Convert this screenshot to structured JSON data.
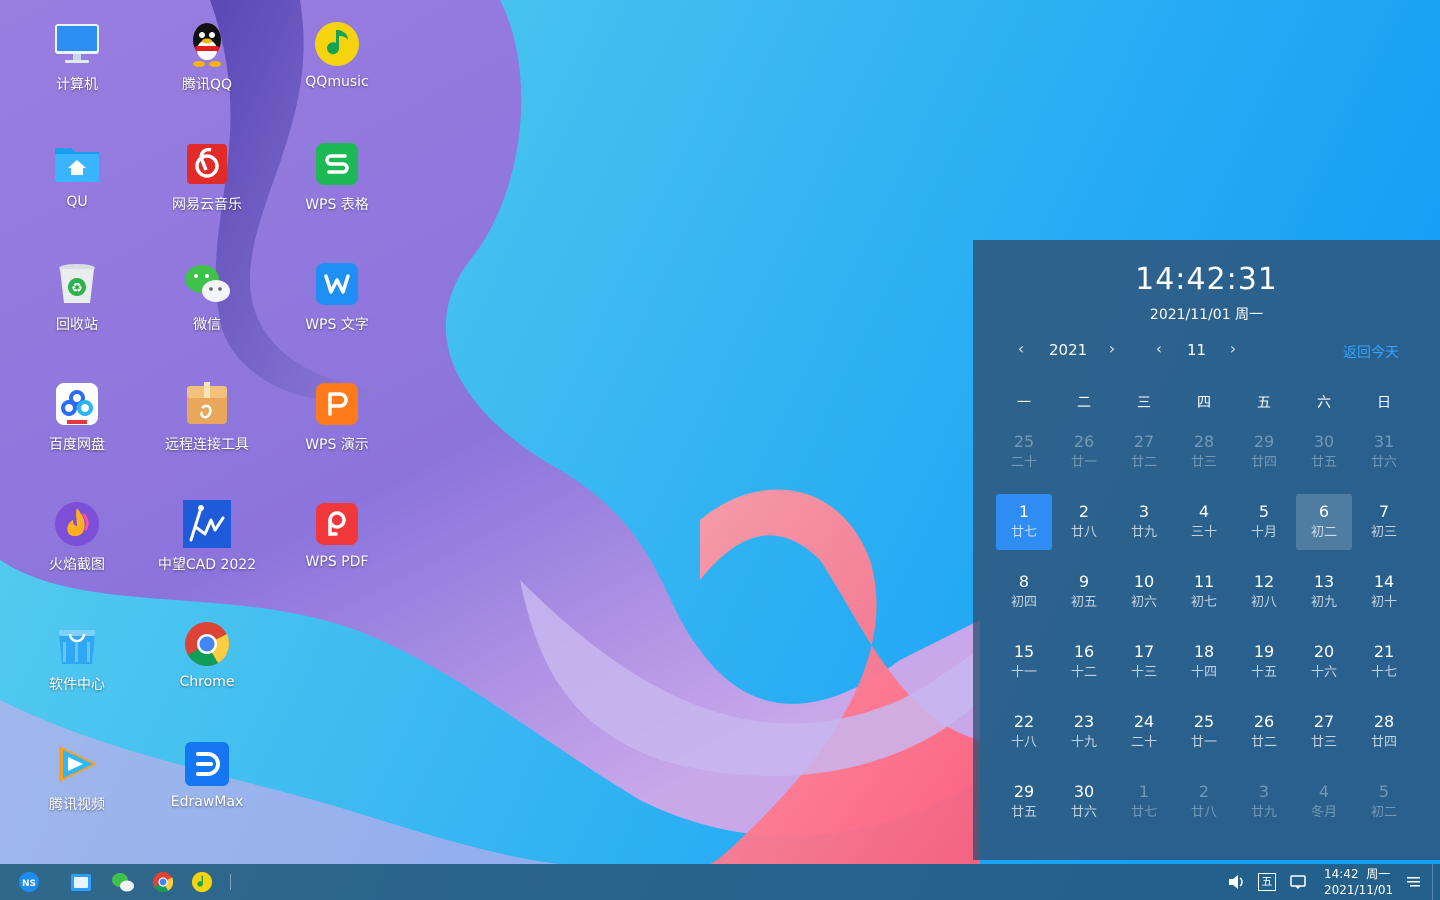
{
  "desktop": {
    "icons": [
      {
        "label": "计算机",
        "icon": "computer-icon"
      },
      {
        "label": "腾讯QQ",
        "icon": "qq-penguin-icon"
      },
      {
        "label": "QQmusic",
        "icon": "qq-music-icon"
      },
      {
        "label": "QU",
        "icon": "home-folder-icon"
      },
      {
        "label": "网易云音乐",
        "icon": "netease-music-icon"
      },
      {
        "label": "WPS 表格",
        "icon": "wps-spreadsheet-icon"
      },
      {
        "label": "回收站",
        "icon": "recycle-bin-icon"
      },
      {
        "label": "微信",
        "icon": "wechat-icon"
      },
      {
        "label": "WPS 文字",
        "icon": "wps-writer-icon"
      },
      {
        "label": "百度网盘",
        "icon": "baidu-netdisk-icon"
      },
      {
        "label": "远程连接工具",
        "icon": "remote-connect-icon"
      },
      {
        "label": "WPS 演示",
        "icon": "wps-presentation-icon"
      },
      {
        "label": "火焰截图",
        "icon": "flameshot-icon"
      },
      {
        "label": "中望CAD 2022",
        "icon": "zwcad-icon"
      },
      {
        "label": "WPS PDF",
        "icon": "wps-pdf-icon"
      },
      {
        "label": "软件中心",
        "icon": "software-center-icon"
      },
      {
        "label": "Chrome",
        "icon": "chrome-icon"
      },
      {
        "label": "腾讯视频",
        "icon": "tencent-video-icon"
      },
      {
        "label": "EdrawMax",
        "icon": "edrawmax-icon"
      }
    ]
  },
  "calendar": {
    "time": "14:42:31",
    "date_line": "2021/11/01   周一",
    "year": "2021",
    "month": "11",
    "today_link": "返回今天",
    "weekdays": [
      "一",
      "二",
      "三",
      "四",
      "五",
      "六",
      "日"
    ],
    "days": [
      {
        "n": "25",
        "l": "二十",
        "other": true
      },
      {
        "n": "26",
        "l": "廿一",
        "other": true
      },
      {
        "n": "27",
        "l": "廿二",
        "other": true
      },
      {
        "n": "28",
        "l": "廿三",
        "other": true
      },
      {
        "n": "29",
        "l": "廿四",
        "other": true
      },
      {
        "n": "30",
        "l": "廿五",
        "other": true
      },
      {
        "n": "31",
        "l": "廿六",
        "other": true
      },
      {
        "n": "1",
        "l": "廿七",
        "today": true
      },
      {
        "n": "2",
        "l": "廿八"
      },
      {
        "n": "3",
        "l": "廿九"
      },
      {
        "n": "4",
        "l": "三十"
      },
      {
        "n": "5",
        "l": "十月"
      },
      {
        "n": "6",
        "l": "初二",
        "hover": true
      },
      {
        "n": "7",
        "l": "初三"
      },
      {
        "n": "8",
        "l": "初四"
      },
      {
        "n": "9",
        "l": "初五"
      },
      {
        "n": "10",
        "l": "初六"
      },
      {
        "n": "11",
        "l": "初七"
      },
      {
        "n": "12",
        "l": "初八"
      },
      {
        "n": "13",
        "l": "初九"
      },
      {
        "n": "14",
        "l": "初十"
      },
      {
        "n": "15",
        "l": "十一"
      },
      {
        "n": "16",
        "l": "十二"
      },
      {
        "n": "17",
        "l": "十三"
      },
      {
        "n": "18",
        "l": "十四"
      },
      {
        "n": "19",
        "l": "十五"
      },
      {
        "n": "20",
        "l": "十六"
      },
      {
        "n": "21",
        "l": "十七"
      },
      {
        "n": "22",
        "l": "十八"
      },
      {
        "n": "23",
        "l": "十九"
      },
      {
        "n": "24",
        "l": "二十"
      },
      {
        "n": "25",
        "l": "廿一"
      },
      {
        "n": "26",
        "l": "廿二"
      },
      {
        "n": "27",
        "l": "廿三"
      },
      {
        "n": "28",
        "l": "廿四"
      },
      {
        "n": "29",
        "l": "廿五"
      },
      {
        "n": "30",
        "l": "廿六"
      },
      {
        "n": "1",
        "l": "廿七",
        "other": true
      },
      {
        "n": "2",
        "l": "廿八",
        "other": true
      },
      {
        "n": "3",
        "l": "廿九",
        "other": true
      },
      {
        "n": "4",
        "l": "冬月",
        "other": true
      },
      {
        "n": "5",
        "l": "初二",
        "other": true
      }
    ],
    "colors": {
      "today_bg": "#2f8cf2",
      "link": "#37a3ff"
    }
  },
  "taskbar": {
    "start_icon": "ns-start-icon",
    "pinned": [
      "file-manager-icon",
      "wechat-icon",
      "chrome-icon",
      "qq-music-icon"
    ],
    "tray": {
      "volume_icon": "volume-icon",
      "ime_label": "五",
      "notification_icon": "message-icon",
      "time": "14:42",
      "weekday": "周一",
      "date": "2021/11/01",
      "menu_icon": "hamburger-icon"
    }
  }
}
